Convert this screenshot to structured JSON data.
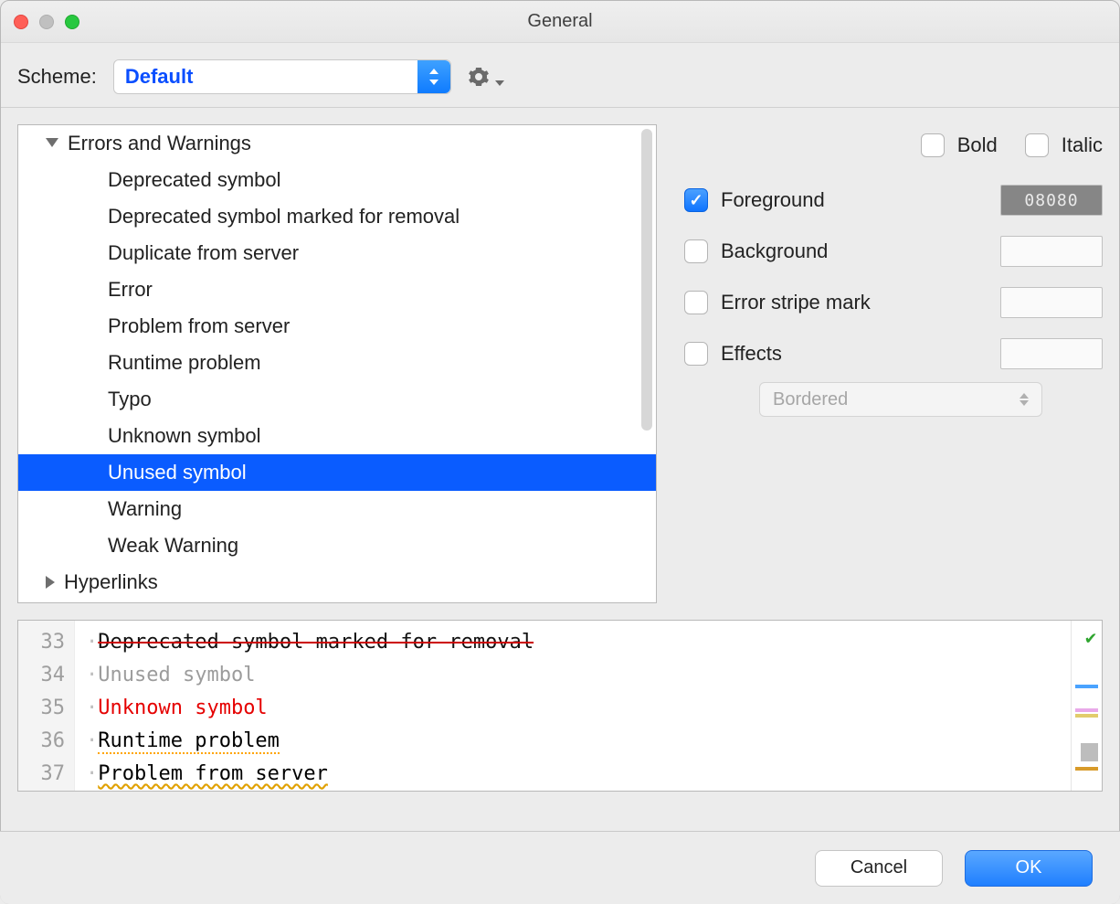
{
  "window": {
    "title": "General"
  },
  "scheme": {
    "label": "Scheme:",
    "value": "Default"
  },
  "tree": {
    "categories": [
      {
        "label": "Errors and Warnings",
        "expanded": true,
        "children": [
          {
            "label": "Deprecated symbol"
          },
          {
            "label": "Deprecated symbol marked for removal"
          },
          {
            "label": "Duplicate from server"
          },
          {
            "label": "Error"
          },
          {
            "label": "Problem from server"
          },
          {
            "label": "Runtime problem"
          },
          {
            "label": "Typo"
          },
          {
            "label": "Unknown symbol"
          },
          {
            "label": "Unused symbol",
            "selected": true
          },
          {
            "label": "Warning"
          },
          {
            "label": "Weak Warning"
          }
        ]
      },
      {
        "label": "Hyperlinks",
        "expanded": false
      }
    ]
  },
  "options": {
    "bold": {
      "label": "Bold",
      "checked": false
    },
    "italic": {
      "label": "Italic",
      "checked": false
    },
    "foreground": {
      "label": "Foreground",
      "checked": true,
      "value": "08080"
    },
    "background": {
      "label": "Background",
      "checked": false
    },
    "error_stripe": {
      "label": "Error stripe mark",
      "checked": false
    },
    "effects": {
      "label": "Effects",
      "checked": false,
      "type": "Bordered"
    }
  },
  "preview": {
    "lines": [
      {
        "num": "33",
        "text": "Deprecated symbol marked for removal",
        "style": "strike"
      },
      {
        "num": "34",
        "text": "Unused symbol",
        "style": "grey"
      },
      {
        "num": "35",
        "text": "Unknown symbol",
        "style": "red"
      },
      {
        "num": "36",
        "text": "Runtime problem",
        "style": "u-orange"
      },
      {
        "num": "37",
        "text": "Problem from server",
        "style": "u-wave"
      }
    ]
  },
  "footer": {
    "cancel": "Cancel",
    "ok": "OK"
  }
}
